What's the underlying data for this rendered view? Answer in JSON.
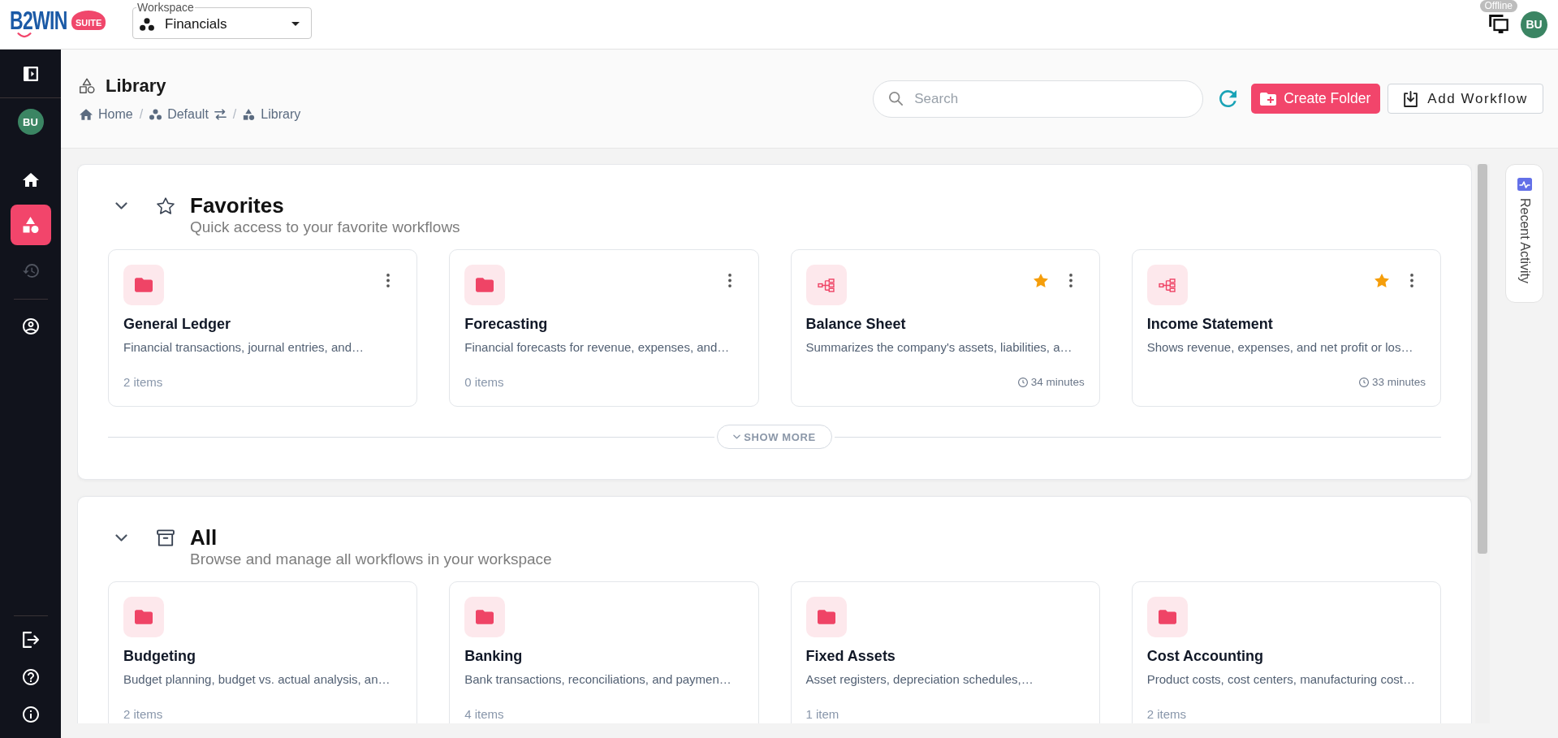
{
  "topbar": {
    "logo": {
      "wordmark": "B2WIN",
      "badge": "SUITE"
    },
    "workspace": {
      "label": "Workspace",
      "value": "Financials"
    },
    "connection_status": "Offline",
    "user_initials": "BU"
  },
  "sidebar": {
    "user_initials": "BU",
    "nav": [
      {
        "kind": "home",
        "selected": false,
        "disabled": false
      },
      {
        "kind": "library",
        "selected": true,
        "disabled": false
      },
      {
        "kind": "history",
        "selected": false,
        "disabled": true
      }
    ],
    "account": [
      {
        "kind": "profile",
        "selected": false,
        "disabled": false
      }
    ],
    "footer": [
      {
        "kind": "logout"
      },
      {
        "kind": "help"
      },
      {
        "kind": "info"
      }
    ]
  },
  "page_header": {
    "title": "Library",
    "breadcrumb": [
      {
        "kind": "home",
        "label": "Home",
        "switchable": false
      },
      {
        "kind": "workspace",
        "separator": "/",
        "label": "Default",
        "switchable": true
      },
      {
        "kind": "library",
        "separator": "/",
        "label": "Library",
        "switchable": false
      }
    ],
    "search": {
      "placeholder": "Search"
    },
    "actions": [
      {
        "kind": "create_folder",
        "label": "Create Folder"
      },
      {
        "kind": "add_workflow",
        "label": "Add Workflow"
      }
    ]
  },
  "sections": [
    {
      "kind": "favorites",
      "title": "Favorites",
      "subtitle": "Quick access to your favorite workflows",
      "expanded": true,
      "cards": [
        {
          "kind": "folder",
          "title": "General Ledger",
          "description": "Financial transactions, journal entries, and…",
          "count": "2 items",
          "starred": false,
          "menu": true
        },
        {
          "kind": "folder",
          "title": "Forecasting",
          "description": "Financial forecasts for revenue, expenses, and…",
          "count": "0 items",
          "starred": false,
          "menu": true
        },
        {
          "kind": "workflow",
          "title": "Balance Sheet",
          "description": "Summarizes the company's assets, liabilities, a…",
          "updated": "34 minutes",
          "starred": true,
          "menu": true
        },
        {
          "kind": "workflow",
          "title": "Income Statement",
          "description": "Shows revenue, expenses, and net profit or los…",
          "updated": "33 minutes",
          "starred": true,
          "menu": true
        }
      ],
      "show_more": "SHOW MORE"
    },
    {
      "kind": "all",
      "title": "All",
      "subtitle": "Browse and manage all workflows in your workspace",
      "expanded": true,
      "cards": [
        {
          "kind": "folder",
          "title": "Budgeting",
          "description": "Budget planning, budget vs. actual analysis, an…",
          "count": "2 items",
          "starred": false,
          "menu": false
        },
        {
          "kind": "folder",
          "title": "Banking",
          "description": "Bank transactions, reconciliations, and paymen…",
          "count": "4 items",
          "starred": false,
          "menu": false
        },
        {
          "kind": "folder",
          "title": "Fixed Assets",
          "description": "Asset registers, depreciation schedules,…",
          "count": "1 item",
          "starred": false,
          "menu": false
        },
        {
          "kind": "folder",
          "title": "Cost Accounting",
          "description": "Product costs, cost centers, manufacturing cost…",
          "count": "2 items",
          "starred": false,
          "menu": false
        }
      ]
    }
  ],
  "side_tab": {
    "label": "Recent Activity"
  }
}
